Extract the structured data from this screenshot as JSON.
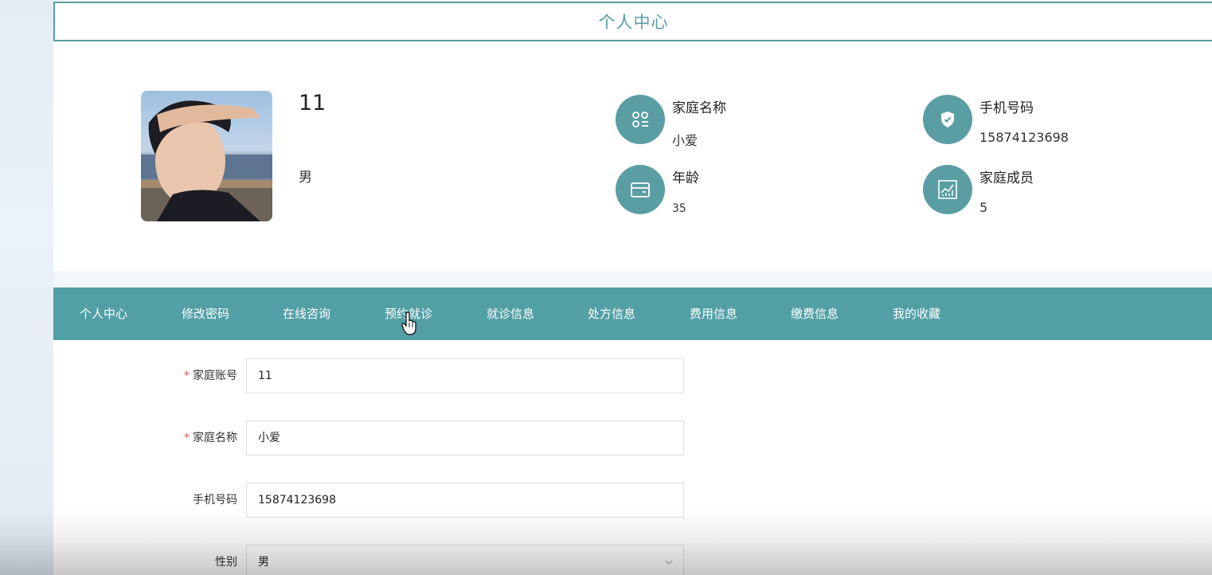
{
  "header": {
    "title": "个人中心"
  },
  "profile": {
    "username": "11",
    "gender": "男",
    "stats": [
      {
        "icon": "apps-icon",
        "label": "家庭名称",
        "value": "小爱"
      },
      {
        "icon": "shield-check-icon",
        "label": "手机号码",
        "value": "15874123698"
      },
      {
        "icon": "wallet-icon",
        "label": "年龄",
        "value": "35"
      },
      {
        "icon": "chart-icon",
        "label": "家庭成员",
        "value": "5"
      }
    ]
  },
  "nav": {
    "items": [
      {
        "label": "个人中心"
      },
      {
        "label": "修改密码"
      },
      {
        "label": "在线咨询"
      },
      {
        "label": "预约就诊"
      },
      {
        "label": "就诊信息"
      },
      {
        "label": "处方信息"
      },
      {
        "label": "费用信息"
      },
      {
        "label": "缴费信息"
      },
      {
        "label": "我的收藏"
      }
    ]
  },
  "form": {
    "account": {
      "label": "家庭账号",
      "value": "11",
      "required": "*"
    },
    "family_name": {
      "label": "家庭名称",
      "value": "小爱",
      "required": "*"
    },
    "phone": {
      "label": "手机号码",
      "value": "15874123698"
    },
    "gender": {
      "label": "性别",
      "value": "男"
    }
  },
  "colors": {
    "accent": "#529fa6",
    "required": "#e05454"
  }
}
